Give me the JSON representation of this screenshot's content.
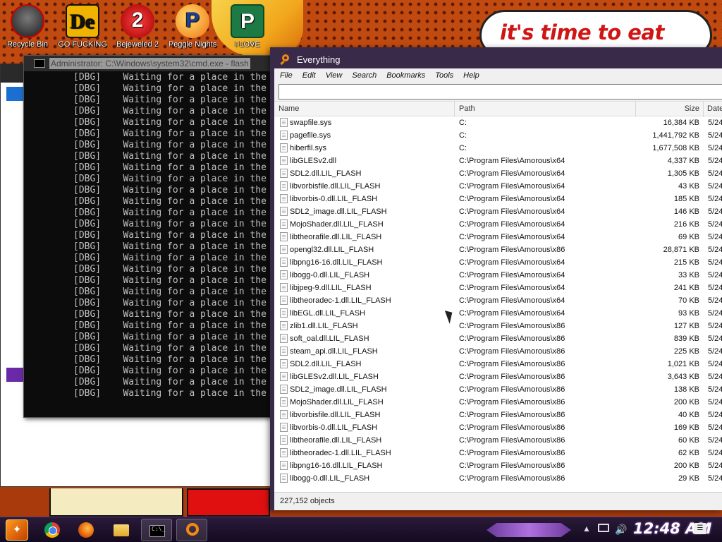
{
  "wallpaper": {
    "speech_text": "it's time to eat shit"
  },
  "desktop_icons": [
    {
      "label": "Recycle Bin",
      "icon": "recycle-bin-icon"
    },
    {
      "label": "GO FUCKING",
      "icon": "de-app-icon",
      "glyph": "De"
    },
    {
      "label": "Bejeweled 2",
      "icon": "bejeweled-icon",
      "glyph": "2"
    },
    {
      "label": "Peggle Nights",
      "icon": "peggle-icon",
      "glyph": "P"
    },
    {
      "label": "I LOVE",
      "icon": "publisher-icon",
      "glyph": "P"
    }
  ],
  "cmd": {
    "title": "Administrator: C:\\Windows\\system32\\cmd.exe - flash",
    "lines": [
      "[DBG]    Waiting for a place in the",
      "[DBG]    Waiting for a place in the",
      "[DBG]    Waiting for a place in the",
      "[DBG]    Waiting for a place in the",
      "[DBG]    Waiting for a place in the",
      "[DBG]    Waiting for a place in the",
      "[DBG]    Waiting for a place in the",
      "[DBG]    Waiting for a place in the",
      "[DBG]    Waiting for a place in the",
      "[DBG]    Waiting for a place in the",
      "[DBG]    Waiting for a place in the",
      "[DBG]    Waiting for a place in the",
      "[DBG]    Waiting for a place in the",
      "[DBG]    Waiting for a place in the",
      "[DBG]    Waiting for a place in the",
      "[DBG]    Waiting for a place in the",
      "[DBG]    Waiting for a place in the",
      "[DBG]    Waiting for a place in the",
      "[DBG]    Waiting for a place in the",
      "[DBG]    Waiting for a place in the",
      "[DBG]    Waiting for a place in the",
      "[DBG]    Waiting for a place in the",
      "[DBG]    Waiting for a place in the",
      "[DBG]    Waiting for a place in the",
      "[DBG]    Waiting for a place in the",
      "[DBG]    Waiting for a place in the",
      "[DBG]    Waiting for a place in the",
      "[DBG]    Waiting for a place in the",
      "[DBG]    Waiting for a place in the"
    ]
  },
  "everything": {
    "title": "Everything",
    "menu": [
      "File",
      "Edit",
      "View",
      "Search",
      "Bookmarks",
      "Tools",
      "Help"
    ],
    "search": {
      "value": "",
      "placeholder": ""
    },
    "columns": {
      "name": "Name",
      "path": "Path",
      "size": "Size",
      "date": "Date"
    },
    "rows": [
      {
        "name": "swapfile.sys",
        "path": "C:",
        "size": "16,384 KB",
        "date": "5/24"
      },
      {
        "name": "pagefile.sys",
        "path": "C:",
        "size": "1,441,792 KB",
        "date": "5/24"
      },
      {
        "name": "hiberfil.sys",
        "path": "C:",
        "size": "1,677,508 KB",
        "date": "5/24"
      },
      {
        "name": "libGLESv2.dll",
        "path": "C:\\Program Files\\Amorous\\x64",
        "size": "4,337 KB",
        "date": "5/24"
      },
      {
        "name": "SDL2.dll.LIL_FLASH",
        "path": "C:\\Program Files\\Amorous\\x64",
        "size": "1,305 KB",
        "date": "5/24"
      },
      {
        "name": "libvorbisfile.dll.LIL_FLASH",
        "path": "C:\\Program Files\\Amorous\\x64",
        "size": "43 KB",
        "date": "5/24"
      },
      {
        "name": "libvorbis-0.dll.LIL_FLASH",
        "path": "C:\\Program Files\\Amorous\\x64",
        "size": "185 KB",
        "date": "5/24"
      },
      {
        "name": "SDL2_image.dll.LIL_FLASH",
        "path": "C:\\Program Files\\Amorous\\x64",
        "size": "146 KB",
        "date": "5/24"
      },
      {
        "name": "MojoShader.dll.LIL_FLASH",
        "path": "C:\\Program Files\\Amorous\\x64",
        "size": "216 KB",
        "date": "5/24"
      },
      {
        "name": "libtheorafile.dll.LIL_FLASH",
        "path": "C:\\Program Files\\Amorous\\x64",
        "size": "69 KB",
        "date": "5/24"
      },
      {
        "name": "opengl32.dll.LIL_FLASH",
        "path": "C:\\Program Files\\Amorous\\x86",
        "size": "28,871 KB",
        "date": "5/24"
      },
      {
        "name": "libpng16-16.dll.LIL_FLASH",
        "path": "C:\\Program Files\\Amorous\\x64",
        "size": "215 KB",
        "date": "5/24"
      },
      {
        "name": "libogg-0.dll.LIL_FLASH",
        "path": "C:\\Program Files\\Amorous\\x64",
        "size": "33 KB",
        "date": "5/24"
      },
      {
        "name": "libjpeg-9.dll.LIL_FLASH",
        "path": "C:\\Program Files\\Amorous\\x64",
        "size": "241 KB",
        "date": "5/24"
      },
      {
        "name": "libtheoradec-1.dll.LIL_FLASH",
        "path": "C:\\Program Files\\Amorous\\x64",
        "size": "70 KB",
        "date": "5/24"
      },
      {
        "name": "libEGL.dll.LIL_FLASH",
        "path": "C:\\Program Files\\Amorous\\x64",
        "size": "93 KB",
        "date": "5/24"
      },
      {
        "name": "zlib1.dll.LIL_FLASH",
        "path": "C:\\Program Files\\Amorous\\x86",
        "size": "127 KB",
        "date": "5/24"
      },
      {
        "name": "soft_oal.dll.LIL_FLASH",
        "path": "C:\\Program Files\\Amorous\\x86",
        "size": "839 KB",
        "date": "5/24"
      },
      {
        "name": "steam_api.dll.LIL_FLASH",
        "path": "C:\\Program Files\\Amorous\\x86",
        "size": "225 KB",
        "date": "5/24"
      },
      {
        "name": "SDL2.dll.LIL_FLASH",
        "path": "C:\\Program Files\\Amorous\\x86",
        "size": "1,021 KB",
        "date": "5/24"
      },
      {
        "name": "libGLESv2.dll.LIL_FLASH",
        "path": "C:\\Program Files\\Amorous\\x86",
        "size": "3,643 KB",
        "date": "5/24"
      },
      {
        "name": "SDL2_image.dll.LIL_FLASH",
        "path": "C:\\Program Files\\Amorous\\x86",
        "size": "138 KB",
        "date": "5/24"
      },
      {
        "name": "MojoShader.dll.LIL_FLASH",
        "path": "C:\\Program Files\\Amorous\\x86",
        "size": "200 KB",
        "date": "5/24"
      },
      {
        "name": "libvorbisfile.dll.LIL_FLASH",
        "path": "C:\\Program Files\\Amorous\\x86",
        "size": "40 KB",
        "date": "5/24"
      },
      {
        "name": "libvorbis-0.dll.LIL_FLASH",
        "path": "C:\\Program Files\\Amorous\\x86",
        "size": "169 KB",
        "date": "5/24"
      },
      {
        "name": "libtheorafile.dll.LIL_FLASH",
        "path": "C:\\Program Files\\Amorous\\x86",
        "size": "60 KB",
        "date": "5/24"
      },
      {
        "name": "libtheoradec-1.dll.LIL_FLASH",
        "path": "C:\\Program Files\\Amorous\\x86",
        "size": "62 KB",
        "date": "5/24"
      },
      {
        "name": "libpng16-16.dll.LIL_FLASH",
        "path": "C:\\Program Files\\Amorous\\x86",
        "size": "200 KB",
        "date": "5/24"
      },
      {
        "name": "libogg-0.dll.LIL_FLASH",
        "path": "C:\\Program Files\\Amorous\\x86",
        "size": "29 KB",
        "date": "5/24"
      }
    ],
    "status": "227,152 objects"
  },
  "taskbar": {
    "start_icon": "start-orb-icon",
    "apps": [
      {
        "name": "chrome",
        "icon": "chrome-icon",
        "active": false
      },
      {
        "name": "firefox",
        "icon": "firefox-icon",
        "active": false
      },
      {
        "name": "explorer",
        "icon": "folder-icon",
        "active": false
      },
      {
        "name": "cmd",
        "icon": "cmd-icon",
        "active": true
      },
      {
        "name": "everything",
        "icon": "everything-icon",
        "active": true
      }
    ],
    "clock": "12:48 AM"
  },
  "colors": {
    "titlebar": "#3a2a4a",
    "wallpaper": "#c04a10",
    "accent": "#f28a10",
    "speech_text": "#d01515"
  }
}
